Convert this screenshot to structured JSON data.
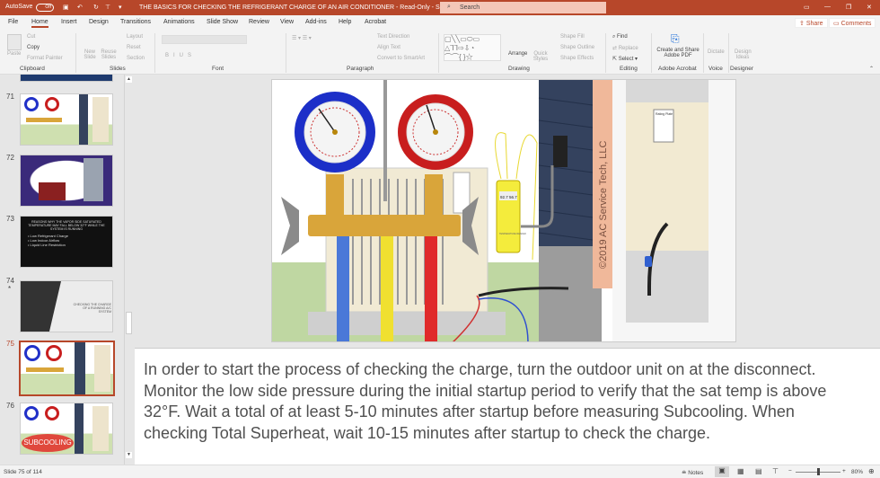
{
  "titlebar": {
    "autosave": "AutoSave",
    "autosave_state": "Off",
    "doc_title": "THE BASICS FOR CHECKING THE REFRIGERANT CHARGE OF AN AIR CONDITIONER  -  Read-Only  -  Saved to this PC  ▾",
    "search_placeholder": "Search"
  },
  "tabs": [
    "File",
    "Home",
    "Insert",
    "Design",
    "Transitions",
    "Animations",
    "Slide Show",
    "Review",
    "View",
    "Add-ins",
    "Help",
    "Acrobat"
  ],
  "share": "Share",
  "comments": "Comments",
  "ribbon": {
    "clipboard": {
      "paste": "Paste",
      "cut": "Cut",
      "copy": "Copy",
      "format_painter": "Format Painter",
      "label": "Clipboard"
    },
    "slides": {
      "new_slide": "New Slide",
      "reuse_slides": "Reuse Slides",
      "layout": "Layout",
      "reset": "Reset",
      "section": "Section",
      "label": "Slides"
    },
    "font": {
      "label": "Font"
    },
    "paragraph": {
      "text_direction": "Text Direction",
      "align_text": "Align Text",
      "convert": "Convert to SmartArt",
      "label": "Paragraph"
    },
    "drawing": {
      "arrange": "Arrange",
      "quick_styles": "Quick Styles",
      "shape_fill": "Shape Fill",
      "shape_outline": "Shape Outline",
      "shape_effects": "Shape Effects",
      "label": "Drawing"
    },
    "editing": {
      "find": "Find",
      "replace": "Replace",
      "select": "Select",
      "label": "Editing"
    },
    "acrobat": {
      "create": "Create and Share Adobe PDF",
      "label": "Adobe Acrobat"
    },
    "voice": {
      "dictate": "Dictate",
      "label": "Voice"
    },
    "designer": {
      "ideas": "Design Ideas",
      "label": "Designer"
    }
  },
  "thumbnails": [
    {
      "num": "71"
    },
    {
      "num": "72"
    },
    {
      "num": "73",
      "title": "REASONS WHY THE VAPOR SIDE SATURATED TEMPERATURE MAY FALL BELOW 32°F WHILE THE SYSTEM IS RUNNING",
      "bullets": [
        "• Low Refrigerant Charge",
        "• Low Indoor Airflow",
        "• Liquid Line Restriction"
      ]
    },
    {
      "num": "74",
      "mark": "*",
      "title": "CHECKING THE CHARGE OF A RUNNING A/C SYSTEM"
    },
    {
      "num": "75"
    },
    {
      "num": "76",
      "badge": "SUBCOOLING"
    }
  ],
  "slide": {
    "watermark": "©2019 AC Service Tech, LLC",
    "meter_label": "TEMPERATURE READER",
    "t1": "92.7",
    "t2": "56.7",
    "plate": "Rating Plate"
  },
  "notes": "In order to start the process of checking the charge, turn the outdoor unit on at the disconnect. Monitor the low side pressure during the initial startup period to verify that the sat temp is above 32°F. Wait a total of at least 5-10 minutes after startup before measuring Subcooling. When checking Total Superheat, wait 10-15 minutes after startup to check the charge.",
  "status": {
    "slide_of": "Slide 75 of 114",
    "notes": "Notes",
    "zoom": "80%",
    "zoom_fraction": 0.5
  }
}
